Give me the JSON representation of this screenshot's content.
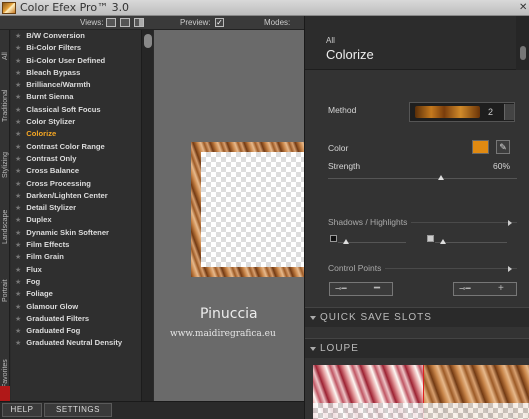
{
  "app": {
    "title": "Color Efex Pro™ 3.0"
  },
  "toolbar": {
    "views_label": "Views:",
    "preview_label": "Preview:",
    "preview_checked": true,
    "modes_label": "Modes:"
  },
  "vertical_tabs": [
    "All",
    "Traditional",
    "Stylizing",
    "Landscape",
    "Portrait",
    "Favorites"
  ],
  "filters": {
    "items": [
      "B/W Conversion",
      "Bi-Color Filters",
      "Bi-Color User Defined",
      "Bleach Bypass",
      "Brilliance/Warmth",
      "Burnt Sienna",
      "Classical Soft Focus",
      "Color Stylizer",
      "Colorize",
      "Contrast Color Range",
      "Contrast Only",
      "Cross Balance",
      "Cross Processing",
      "Darken/Lighten Center",
      "Detail Stylizer",
      "Duplex",
      "Dynamic Skin Softener",
      "Film Effects",
      "Film Grain",
      "Flux",
      "Fog",
      "Foliage",
      "Glamour Glow",
      "Graduated Filters",
      "Graduated Fog",
      "Graduated Neutral Density"
    ],
    "active": "Colorize"
  },
  "bottom": {
    "help_label": "HELP",
    "settings_label": "SETTINGS"
  },
  "watermark": {
    "name": "Pinuccia",
    "url": "www.maidiregrafica.eu"
  },
  "panel": {
    "breadcrumb": "All",
    "title": "Colorize",
    "method_label": "Method",
    "method_value": "2",
    "color_label": "Color",
    "color_value": "#e08a12",
    "strength_label": "Strength",
    "strength_value": "60%",
    "strength_fraction": 0.6,
    "shadows_label": "Shadows / Highlights",
    "control_points_label": "Control Points",
    "quick_save_label": "QUICK SAVE SLOTS",
    "loupe_label": "LOUPE"
  }
}
